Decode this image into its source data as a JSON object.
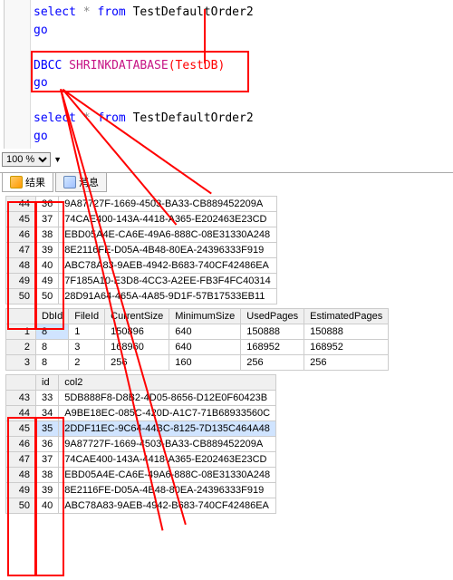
{
  "editor": {
    "line1_kw1": "select",
    "line1_star": "*",
    "line1_kw2": "from",
    "line1_obj": "TestDefaultOrder2",
    "go": "go",
    "line3_kw": "DBCC",
    "line3_cmd": "SHRINKDATABASE",
    "line3_arg": "(TestDB)",
    "line5_kw1": "select",
    "line5_star": "*",
    "line5_kw2": "from",
    "line5_obj": "TestDefaultOrder2"
  },
  "zoom": {
    "value": "100 %"
  },
  "tabs": {
    "results": "结果",
    "messages": "消息"
  },
  "grid1": {
    "rows": [
      {
        "idx": 44,
        "c1": 36,
        "c2": "9A87727F-1669-4503-BA33-CB889452209A"
      },
      {
        "idx": 45,
        "c1": 37,
        "c2": "74CAE400-143A-4418-A365-E202463E23CD"
      },
      {
        "idx": 46,
        "c1": 38,
        "c2": "EBD05A4E-CA6E-49A6-888C-08E31330A248"
      },
      {
        "idx": 47,
        "c1": 39,
        "c2": "8E2116FE-D05A-4B48-80EA-24396333F919"
      },
      {
        "idx": 48,
        "c1": 40,
        "c2": "ABC78A83-9AEB-4942-B683-740CF42486EA"
      },
      {
        "idx": 49,
        "c1": 49,
        "c2": "7F185A10-E3D8-4CC3-A2EE-FB3F4FC40314"
      },
      {
        "idx": 50,
        "c1": 50,
        "c2": "28D91A64-465A-4A85-9D1F-57B17533EB11"
      }
    ]
  },
  "grid2": {
    "headers": [
      "DbId",
      "FileId",
      "CurrentSize",
      "MinimumSize",
      "UsedPages",
      "EstimatedPages"
    ],
    "rows": [
      {
        "idx": 1,
        "cells": [
          "8",
          "1",
          "150896",
          "640",
          "150888",
          "150888"
        ]
      },
      {
        "idx": 2,
        "cells": [
          "8",
          "3",
          "168960",
          "640",
          "168952",
          "168952"
        ]
      },
      {
        "idx": 3,
        "cells": [
          "8",
          "2",
          "256",
          "160",
          "256",
          "256"
        ]
      }
    ]
  },
  "grid3": {
    "headers": [
      "id",
      "col2"
    ],
    "rows": [
      {
        "idx": 43,
        "id": 33,
        "col2": "5DB888F8-D8B2-4D05-8656-D12E0F60423B"
      },
      {
        "idx": 44,
        "id": 34,
        "col2": "A9BE18EC-085C-420D-A1C7-71B68933560C"
      },
      {
        "idx": 45,
        "id": 35,
        "col2": "2DDF11EC-9C64-44BC-8125-7D135C464A48"
      },
      {
        "idx": 46,
        "id": 36,
        "col2": "9A87727F-1669-4503-BA33-CB889452209A"
      },
      {
        "idx": 47,
        "id": 37,
        "col2": "74CAE400-143A-4418-A365-E202463E23CD"
      },
      {
        "idx": 48,
        "id": 38,
        "col2": "EBD05A4E-CA6E-49A6-888C-08E31330A248"
      },
      {
        "idx": 49,
        "id": 39,
        "col2": "8E2116FE-D05A-4B48-80EA-24396333F919"
      },
      {
        "idx": 50,
        "id": 40,
        "col2": "ABC78A83-9AEB-4942-B683-740CF42486EA"
      }
    ]
  }
}
